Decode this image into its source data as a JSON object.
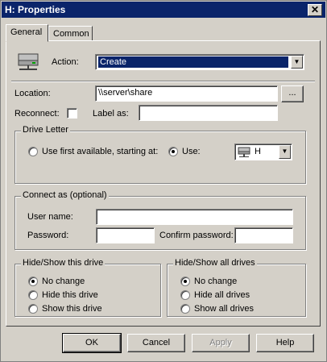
{
  "window": {
    "title": "H: Properties",
    "close_glyph": "✕"
  },
  "tabs": [
    {
      "label": "General"
    },
    {
      "label": "Common"
    }
  ],
  "action": {
    "label": "Action:",
    "value": "Create"
  },
  "location": {
    "label": "Location:",
    "value": "\\\\server\\share",
    "browse_label": "..."
  },
  "reconnect": {
    "label": "Reconnect:",
    "checked": false
  },
  "label_as": {
    "label": "Label as:",
    "value": ""
  },
  "drive_letter": {
    "title": "Drive Letter",
    "option_first": "Use first available, starting at:",
    "option_use": "Use:",
    "selected": "use",
    "letter": "H"
  },
  "connect_as": {
    "title": "Connect as (optional)",
    "username_label": "User name:",
    "username_value": "",
    "password_label": "Password:",
    "password_value": "",
    "confirm_label": "Confirm password:",
    "confirm_value": ""
  },
  "hide_show_drive": {
    "title": "Hide/Show this drive",
    "options": [
      "No change",
      "Hide this drive",
      "Show this drive"
    ],
    "selected": 0
  },
  "hide_show_all": {
    "title": "Hide/Show all drives",
    "options": [
      "No change",
      "Hide all drives",
      "Show all drives"
    ],
    "selected": 0
  },
  "buttons": {
    "ok": "OK",
    "cancel": "Cancel",
    "apply": "Apply",
    "help": "Help"
  },
  "colors": {
    "selection": "#0a246a",
    "face": "#d4d0c8"
  }
}
